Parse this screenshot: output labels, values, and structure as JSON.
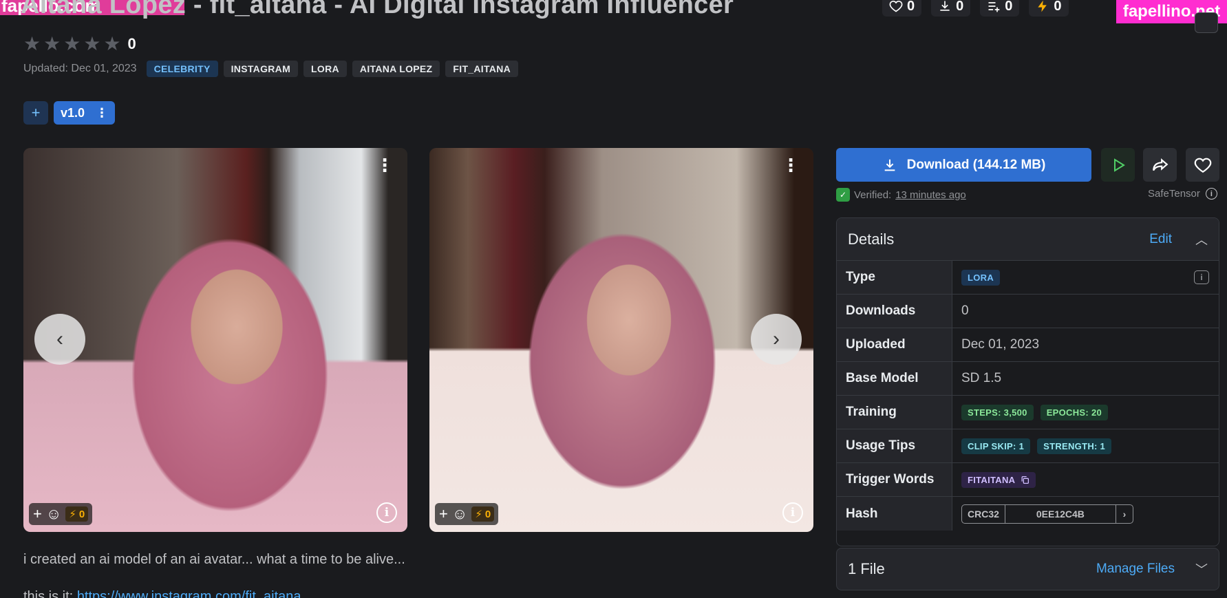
{
  "header": {
    "title": "Aitana Lopez - fit_aitana - AI Digital Instagram Influencer",
    "stats": [
      {
        "icon": "heart-icon",
        "value": "0"
      },
      {
        "icon": "download-icon",
        "value": "0"
      },
      {
        "icon": "playlist-add-icon",
        "value": "0"
      },
      {
        "icon": "bolt-icon",
        "value": "0"
      }
    ],
    "rating_count": "0",
    "updated": "Updated: Dec 01, 2023",
    "tags": [
      "CELEBRITY",
      "INSTAGRAM",
      "LORA",
      "AITANA LOPEZ",
      "FIT_AITANA"
    ]
  },
  "watermarks": {
    "left": "fapello.com",
    "right": "fapellino.net"
  },
  "versions": {
    "add_label": "+",
    "current": "v1.0",
    "menu_label": "⋮"
  },
  "gallery": {
    "cards": [
      {
        "reaction_count": "0"
      },
      {
        "reaction_count": "0"
      }
    ]
  },
  "description": {
    "line1": "i created an ai model of an ai avatar... what a time to be alive...",
    "line2_prefix": "this is it:",
    "line2_link": "https://www.instagram.com/fit_aitana"
  },
  "download": {
    "label": "Download (144.12 MB)",
    "verified_prefix": "Verified:",
    "verified_time": "13 minutes ago",
    "format": "SafeTensor"
  },
  "details": {
    "title": "Details",
    "edit_label": "Edit",
    "rows": {
      "type": {
        "label": "Type",
        "value": "LORA"
      },
      "downloads": {
        "label": "Downloads",
        "value": "0"
      },
      "uploaded": {
        "label": "Uploaded",
        "value": "Dec 01, 2023"
      },
      "base_model": {
        "label": "Base Model",
        "value": "SD 1.5"
      },
      "training": {
        "label": "Training",
        "steps": "STEPS: 3,500",
        "epochs": "EPOCHS: 20"
      },
      "usage_tips": {
        "label": "Usage Tips",
        "clip_skip": "CLIP SKIP: 1",
        "strength": "STRENGTH: 1"
      },
      "trigger_words": {
        "label": "Trigger Words",
        "value": "FITAITANA"
      },
      "hash": {
        "label": "Hash",
        "type": "CRC32",
        "value": "0EE12C4B"
      }
    }
  },
  "files": {
    "title": "1 File",
    "manage_label": "Manage Files"
  },
  "colors": {
    "background": "#1a1b1e",
    "primary": "#2f6fd1",
    "link": "#4dabf7"
  }
}
